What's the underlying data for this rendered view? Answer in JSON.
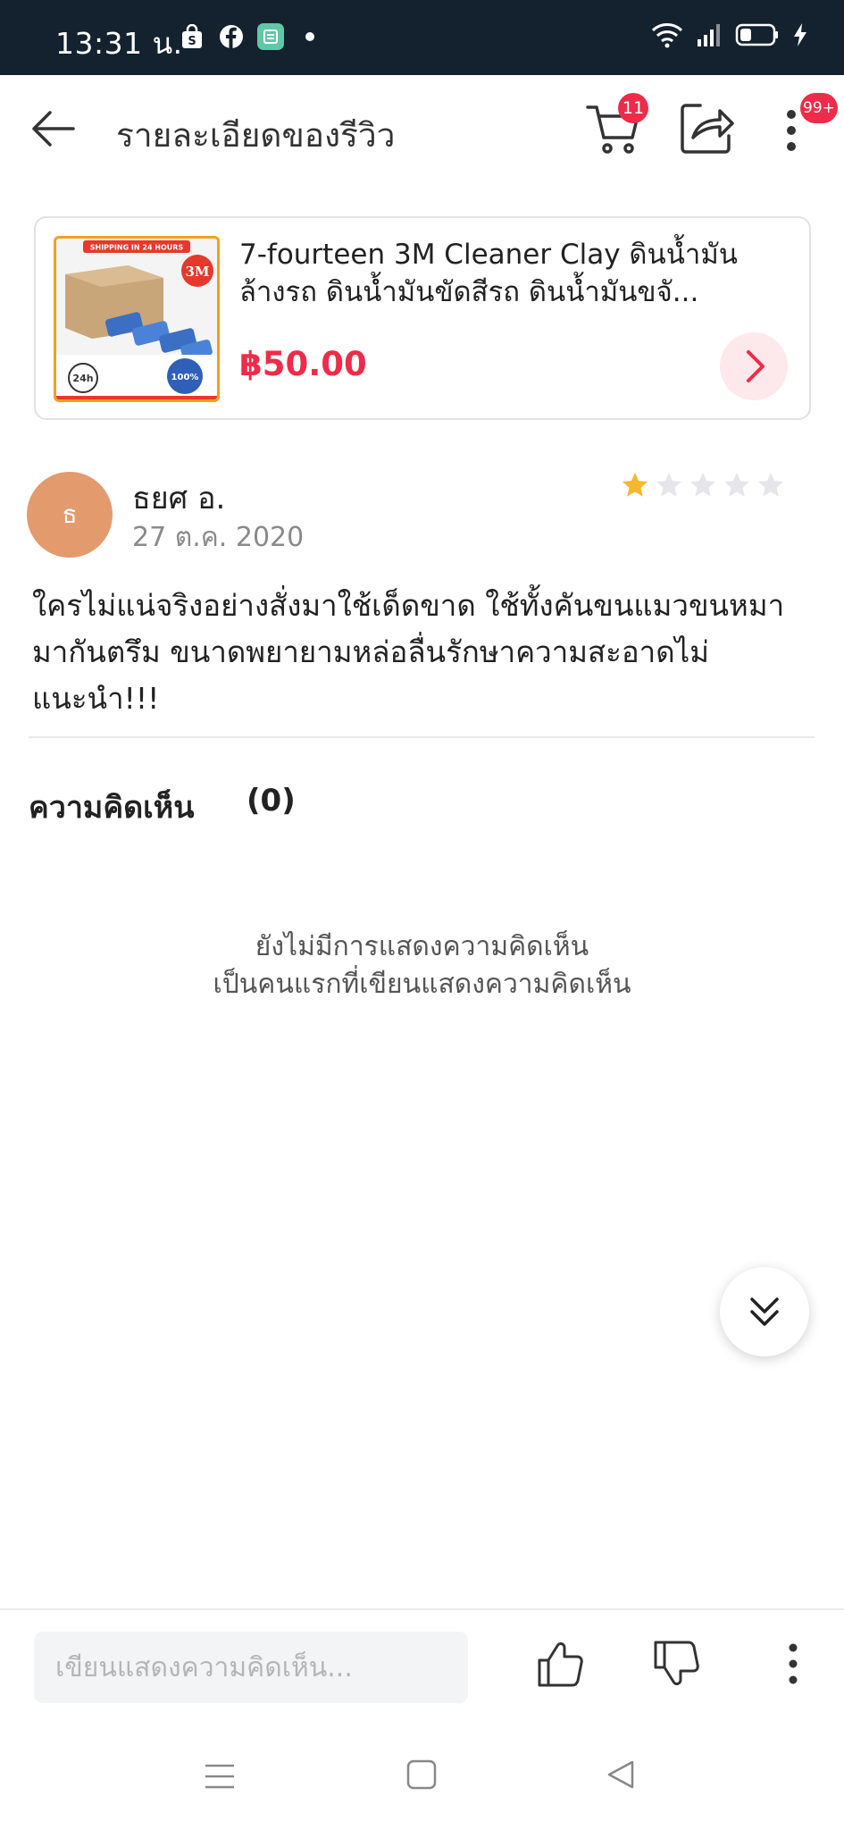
{
  "status_bar": {
    "time": "13:31 น.",
    "icons": [
      "shopee-icon",
      "facebook-icon",
      "app-icon",
      "dot-icon",
      "wifi-icon",
      "signal-icon",
      "battery-icon",
      "charging-icon"
    ]
  },
  "header": {
    "title": "รายละเอียดของรีวิว",
    "cart_badge": "11",
    "more_badge": "99+"
  },
  "product": {
    "name": "7-fourteen 3M Cleaner Clay ดินน้ำมันล้างรถ ดินน้ำมันขัดสีรถ ดินน้ำมันขจั...",
    "price": "฿50.00",
    "thumb_banner": "SHIPPING IN 24 HOURS",
    "thumb_brand": "3M",
    "thumb_badge_left": "24h",
    "thumb_badge_right": "100%"
  },
  "review": {
    "avatar_initial": "ธ",
    "reviewer_name": "ธยศ อ.",
    "date": "27 ต.ค. 2020",
    "rating": 1,
    "max_rating": 5,
    "text": "ใครไม่แน่จริงอย่างสั่งมาใช้เด็ดขาด ใช้ทั้งคันขนแมวขนหมามากันตรึม ขนาดพยายามหล่อลื่นรักษาความสะอาดไม่แนะนำ!!!"
  },
  "comments": {
    "title": "ความคิดเห็น",
    "count": "(0)",
    "empty_line1": "ยังไม่มีการแสดงความคิดเห็น",
    "empty_line2": "เป็นคนแรกที่เขียนแสดงความคิดเห็น"
  },
  "bottom_bar": {
    "input_placeholder": "เขียนแสดงความคิดเห็น..."
  },
  "colors": {
    "accent": "#ee2c4a",
    "status_bar_bg": "#14212e",
    "star_filled": "#f5b82e",
    "star_empty": "#e6e6ea",
    "avatar_bg": "#e39a6d"
  }
}
